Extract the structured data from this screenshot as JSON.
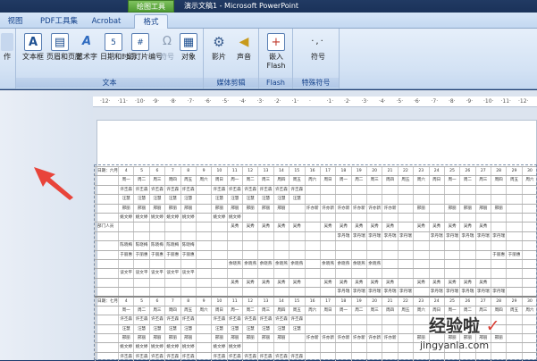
{
  "window": {
    "title": "演示文稿1 - Microsoft PowerPoint",
    "context_tab_group": "绘图工具"
  },
  "tabs": [
    {
      "label": "视图"
    },
    {
      "label": "PDF工具集"
    },
    {
      "label": "Acrobat"
    },
    {
      "label": "格式"
    }
  ],
  "ribbon": {
    "groups": [
      {
        "label": "文本",
        "buttons": [
          "文本框",
          "页眉和页脚",
          "艺术字",
          "日期和时间",
          "幻灯片编号",
          "符号",
          "对象"
        ]
      },
      {
        "label": "媒体剪辑",
        "buttons": [
          "影片",
          "声音"
        ]
      },
      {
        "label": "Flash",
        "buttons": [
          "嵌入Flash"
        ]
      },
      {
        "label": "特殊符号",
        "buttons": [
          "符号"
        ]
      }
    ],
    "cut_label": "作"
  },
  "ruler_ticks": [
    "·12·",
    "·11·",
    "·10·",
    "·9·",
    "·8·",
    "·7·",
    "·6·",
    "·5·",
    "·4·",
    "·3·",
    "·2·",
    "·1·",
    "·",
    "·1·",
    "·2·",
    "·3·",
    "·4·",
    "·5·",
    "·6·",
    "·7·",
    "·8·",
    "·9·",
    "·10·",
    "·11·",
    "·12·"
  ],
  "table": {
    "header1": [
      "日期：六月",
      "4",
      "5",
      "6",
      "7",
      "8",
      "9",
      "10",
      "11",
      "12",
      "13",
      "14",
      "15",
      "16",
      "17",
      "18",
      "19",
      "20",
      "21",
      "22",
      "23",
      "24",
      "25",
      "26",
      "27",
      "28",
      "29",
      "30"
    ],
    "header2": [
      "",
      "周一",
      "周二",
      "周三",
      "周四",
      "周五",
      "周六",
      "周日",
      "周一",
      "周二",
      "周三",
      "周四",
      "周五",
      "周六",
      "周日",
      "周一",
      "周二",
      "周三",
      "周四",
      "周五",
      "周六",
      "周日",
      "周一",
      "周二",
      "周三",
      "周四",
      "周五",
      "周六"
    ],
    "dept_label": "部门人员",
    "row_a": [
      "",
      "许丕森",
      "许丕森",
      "许丕森",
      "许丕森",
      "许丕森",
      "",
      "许丕森",
      "许丕森",
      "许丕森",
      "许丕森",
      "许丕森",
      "许丕森",
      "",
      "",
      "",
      "",
      "",
      "",
      "",
      "",
      "",
      "",
      "",
      "",
      "",
      "",
      ""
    ],
    "row_b": [
      "",
      "汪慧",
      "汪慧",
      "汪慧",
      "汪慧",
      "汪慧",
      "",
      "汪慧",
      "汪慧",
      "汪慧",
      "汪慧",
      "汪慧",
      "汪慧",
      "",
      "",
      "",
      "",
      "",
      "",
      "",
      "",
      "",
      "",
      "",
      "",
      "",
      "",
      ""
    ],
    "row_c": [
      "",
      "邢丽",
      "邢丽",
      "邢丽",
      "邢丽",
      "邢丽",
      "",
      "邢丽",
      "邢丽",
      "邢丽",
      "邢丽",
      "邢丽",
      "",
      "许亦新",
      "许亦新",
      "许亦新",
      "许亦新",
      "许亦新",
      "许亦新",
      "",
      "邢丽",
      "",
      "邢丽",
      "邢丽",
      "邢丽",
      "邢丽",
      "",
      ""
    ],
    "row_d": [
      "",
      "姚文婷",
      "姚文婷",
      "姚文婷",
      "姚文婷",
      "姚文婷",
      "",
      "姚文婷",
      "姚文婷",
      "",
      "",
      "",
      "",
      "",
      "",
      "",
      "",
      "",
      "",
      "",
      "",
      "",
      "",
      "",
      "",
      "",
      "",
      ""
    ],
    "row_e": [
      "",
      "",
      "",
      "",
      "",
      "",
      "",
      "",
      "吴秀",
      "吴秀",
      "吴秀",
      "吴秀",
      "吴秀",
      "",
      "吴秀",
      "吴秀",
      "吴秀",
      "吴秀",
      "吴秀",
      "",
      "吴秀",
      "吴秀",
      "吴秀",
      "吴秀",
      "吴秀",
      "",
      "",
      ""
    ],
    "row_f": [
      "",
      "",
      "",
      "",
      "",
      "",
      "",
      "",
      "",
      "",
      "",
      "",
      "",
      "",
      "",
      "李丹瑞",
      "李丹瑞",
      "李丹瑞",
      "李丹瑞",
      "李丹瑞",
      "",
      "李丹瑞",
      "李丹瑞",
      "李丹瑞",
      "李丹瑞",
      "李丹瑞",
      "",
      ""
    ],
    "row_g": [
      "",
      "陈晓梅",
      "陈晓梅",
      "陈晓梅",
      "陈晓梅",
      "陈晓梅",
      "",
      "",
      "",
      "",
      "",
      "",
      "",
      "",
      "",
      "",
      "",
      "",
      "",
      "",
      "",
      "",
      "",
      "",
      "",
      "",
      "",
      ""
    ],
    "row_h": [
      "",
      "于丽惠",
      "于丽惠",
      "于丽惠",
      "于丽惠",
      "于丽惠",
      "",
      "",
      "",
      "",
      "",
      "",
      "",
      "",
      "",
      "",
      "",
      "",
      "",
      "",
      "",
      "",
      "",
      "",
      "",
      "于丽惠",
      "于丽惠",
      ""
    ],
    "row_i": [
      "",
      "",
      "",
      "",
      "",
      "",
      "",
      "",
      "余晓燕",
      "余晓燕",
      "余晓燕",
      "余晓燕",
      "余晓燕",
      "",
      "余晓燕",
      "余晓燕",
      "余晓燕",
      "余晓燕",
      "",
      "",
      "",
      "",
      "",
      "",
      "",
      "",
      "",
      ""
    ],
    "row_j": [
      "",
      "谈文平",
      "谈文平",
      "谈文平",
      "谈文平",
      "谈文平",
      "",
      "",
      "",
      "",
      "",
      "",
      "",
      "",
      "",
      "",
      "",
      "",
      "",
      "",
      "",
      "",
      "",
      "",
      "",
      "",
      "",
      ""
    ],
    "header3": [
      "日期：七月",
      "4",
      "5",
      "6",
      "7",
      "8",
      "9",
      "10",
      "11",
      "12",
      "13",
      "14",
      "15",
      "16",
      "17",
      "18",
      "19",
      "20",
      "21",
      "22",
      "23",
      "24",
      "25",
      "26",
      "27",
      "28",
      "29",
      "30"
    ]
  },
  "watermark": {
    "text": "经验啦",
    "sub": "jingyanla.com",
    "check": "✓"
  },
  "colors": {
    "ribbon_text": "#15428b",
    "context_tab": "#4f9b32",
    "arrow": "#e8443a"
  }
}
